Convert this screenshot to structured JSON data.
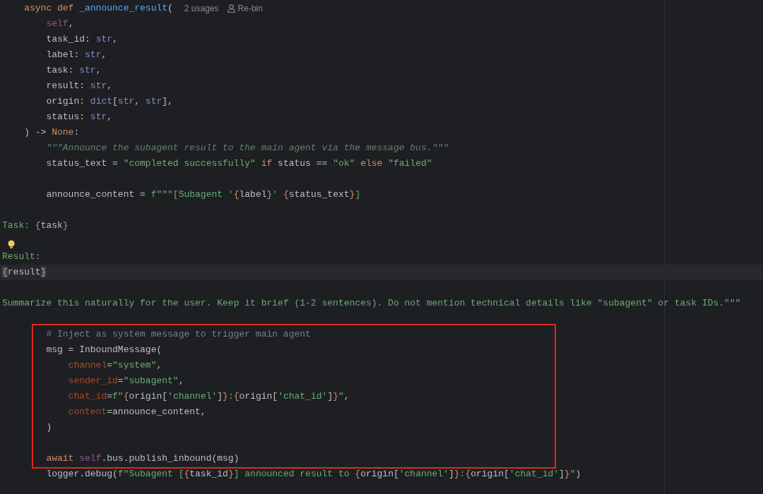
{
  "editor": {
    "blocks": [
      {
        "framed": false,
        "lines": [
          {
            "tokens": [
              {
                "kind": "kw",
                "text": "    async def "
              },
              {
                "kind": "fn",
                "text": "_announce_result"
              },
              {
                "kind": "plain",
                "text": "("
              }
            ],
            "inlays": [
              {
                "kind": "usages",
                "text": "2 usages"
              },
              {
                "kind": "author",
                "text": "Re-bin"
              }
            ],
            "current": false
          },
          {
            "tokens": [
              {
                "kind": "self",
                "text": "        self"
              },
              {
                "kind": "plain",
                "text": ","
              }
            ],
            "current": false
          },
          {
            "tokens": [
              {
                "kind": "plain",
                "text": "        task_id: "
              },
              {
                "kind": "type",
                "text": "str"
              },
              {
                "kind": "plain",
                "text": ","
              }
            ],
            "current": false
          },
          {
            "tokens": [
              {
                "kind": "plain",
                "text": "        label: "
              },
              {
                "kind": "type",
                "text": "str"
              },
              {
                "kind": "plain",
                "text": ","
              }
            ],
            "current": false
          },
          {
            "tokens": [
              {
                "kind": "plain",
                "text": "        task: "
              },
              {
                "kind": "type",
                "text": "str"
              },
              {
                "kind": "plain",
                "text": ","
              }
            ],
            "current": false
          },
          {
            "tokens": [
              {
                "kind": "plain",
                "text": "        result: "
              },
              {
                "kind": "type",
                "text": "str"
              },
              {
                "kind": "plain",
                "text": ","
              }
            ],
            "current": false
          },
          {
            "tokens": [
              {
                "kind": "plain",
                "text": "        origin: "
              },
              {
                "kind": "type",
                "text": "dict"
              },
              {
                "kind": "plain",
                "text": "["
              },
              {
                "kind": "type",
                "text": "str"
              },
              {
                "kind": "plain",
                "text": ", "
              },
              {
                "kind": "type",
                "text": "str"
              },
              {
                "kind": "plain",
                "text": "],"
              }
            ],
            "current": false
          },
          {
            "tokens": [
              {
                "kind": "plain",
                "text": "        status: "
              },
              {
                "kind": "type",
                "text": "str"
              },
              {
                "kind": "plain",
                "text": ","
              }
            ],
            "current": false
          },
          {
            "tokens": [
              {
                "kind": "plain",
                "text": "    ) -> "
              },
              {
                "kind": "kw",
                "text": "None"
              },
              {
                "kind": "plain",
                "text": ":"
              }
            ],
            "current": false
          },
          {
            "tokens": [
              {
                "kind": "doc",
                "text": "        \"\"\"Announce the subagent result to the main agent via the message bus.\"\"\""
              }
            ],
            "current": false
          },
          {
            "tokens": [
              {
                "kind": "plain",
                "text": "        status_text = "
              },
              {
                "kind": "str",
                "text": "\"completed successfully\" "
              },
              {
                "kind": "kw",
                "text": "if"
              },
              {
                "kind": "plain",
                "text": " status == "
              },
              {
                "kind": "str",
                "text": "\"ok\" "
              },
              {
                "kind": "kw",
                "text": "else "
              },
              {
                "kind": "str",
                "text": "\"failed\""
              }
            ],
            "current": false
          },
          {
            "current": false
          },
          {
            "tokens": [
              {
                "kind": "plain",
                "text": "        announce_content = "
              },
              {
                "kind": "str",
                "text": "f\"\"\"[Subagent '"
              },
              {
                "kind": "brace",
                "text": "{"
              },
              {
                "kind": "plain",
                "text": "label"
              },
              {
                "kind": "brace",
                "text": "}"
              },
              {
                "kind": "str",
                "text": "' "
              },
              {
                "kind": "brace",
                "text": "{"
              },
              {
                "kind": "plain",
                "text": "status_text"
              },
              {
                "kind": "brace",
                "text": "}"
              },
              {
                "kind": "str",
                "text": "]"
              }
            ],
            "current": false
          },
          {
            "current": false
          },
          {
            "tokens": [
              {
                "kind": "str",
                "text": "Task: "
              },
              {
                "kind": "brace",
                "text": "{"
              },
              {
                "kind": "plain",
                "text": "task"
              },
              {
                "kind": "brace",
                "text": "}"
              }
            ],
            "current": false
          },
          {
            "current": false
          },
          {
            "tokens": [
              {
                "kind": "str",
                "text": "Result:"
              }
            ],
            "bulb": true,
            "current": false
          },
          {
            "tokens": [
              {
                "kind": "brace_match",
                "text": "{"
              },
              {
                "kind": "plain",
                "text": "result"
              },
              {
                "kind": "brace_match",
                "text": "}"
              }
            ],
            "current": true
          },
          {
            "current": false
          },
          {
            "tokens": [
              {
                "kind": "str",
                "text": "Summarize this naturally for the user. Keep it brief (1-2 sentences). Do not mention technical details like \"subagent\" or task IDs.\"\"\""
              }
            ],
            "current": false
          },
          {
            "current": false
          }
        ]
      },
      {
        "framed": true,
        "lines": [
          {
            "tokens": [
              {
                "kind": "comment",
                "text": "        # Inject as system message to trigger main agent"
              }
            ],
            "current": false
          },
          {
            "tokens": [
              {
                "kind": "plain",
                "text": "        msg = InboundMessage("
              }
            ],
            "current": false
          },
          {
            "tokens": [
              {
                "kind": "param",
                "text": "            channel"
              },
              {
                "kind": "plain",
                "text": "="
              },
              {
                "kind": "str",
                "text": "\"system\""
              },
              {
                "kind": "plain",
                "text": ","
              }
            ],
            "current": false
          },
          {
            "tokens": [
              {
                "kind": "param",
                "text": "            sender_id"
              },
              {
                "kind": "plain",
                "text": "="
              },
              {
                "kind": "str",
                "text": "\"subagent\""
              },
              {
                "kind": "plain",
                "text": ","
              }
            ],
            "current": false
          },
          {
            "tokens": [
              {
                "kind": "param",
                "text": "            chat_id"
              },
              {
                "kind": "plain",
                "text": "="
              },
              {
                "kind": "str",
                "text": "f\""
              },
              {
                "kind": "brace",
                "text": "{"
              },
              {
                "kind": "plain",
                "text": "origin["
              },
              {
                "kind": "str",
                "text": "'channel'"
              },
              {
                "kind": "plain",
                "text": "]"
              },
              {
                "kind": "brace",
                "text": "}"
              },
              {
                "kind": "str",
                "text": ":"
              },
              {
                "kind": "brace",
                "text": "{"
              },
              {
                "kind": "plain",
                "text": "origin["
              },
              {
                "kind": "str",
                "text": "'chat_id'"
              },
              {
                "kind": "plain",
                "text": "]"
              },
              {
                "kind": "brace",
                "text": "}"
              },
              {
                "kind": "str",
                "text": "\""
              },
              {
                "kind": "plain",
                "text": ","
              }
            ],
            "current": false
          },
          {
            "tokens": [
              {
                "kind": "param",
                "text": "            content"
              },
              {
                "kind": "plain",
                "text": "=announce_content,"
              }
            ],
            "current": false
          },
          {
            "tokens": [
              {
                "kind": "plain",
                "text": "        )"
              }
            ],
            "current": false
          },
          {
            "current": false
          },
          {
            "tokens": [
              {
                "kind": "kw",
                "text": "        await "
              },
              {
                "kind": "self",
                "text": "self"
              },
              {
                "kind": "plain",
                "text": ".bus.publish_inbound(msg)"
              }
            ],
            "current": false
          }
        ]
      },
      {
        "framed": false,
        "lines": [
          {
            "tokens": [
              {
                "kind": "plain",
                "text": "        logger.debug("
              },
              {
                "kind": "str",
                "text": "f\"Subagent ["
              },
              {
                "kind": "brace",
                "text": "{"
              },
              {
                "kind": "plain",
                "text": "task_id"
              },
              {
                "kind": "brace",
                "text": "}"
              },
              {
                "kind": "str",
                "text": "] announced result to "
              },
              {
                "kind": "brace",
                "text": "{"
              },
              {
                "kind": "plain",
                "text": "origin["
              },
              {
                "kind": "str",
                "text": "'channel'"
              },
              {
                "kind": "plain",
                "text": "]"
              },
              {
                "kind": "brace",
                "text": "}"
              },
              {
                "kind": "str",
                "text": ":"
              },
              {
                "kind": "brace",
                "text": "{"
              },
              {
                "kind": "plain",
                "text": "origin["
              },
              {
                "kind": "str",
                "text": "'chat_id'"
              },
              {
                "kind": "plain",
                "text": "]"
              },
              {
                "kind": "brace",
                "text": "}"
              },
              {
                "kind": "str",
                "text": "\""
              },
              {
                "kind": "plain",
                "text": ")"
              }
            ],
            "current": false
          }
        ]
      }
    ]
  }
}
